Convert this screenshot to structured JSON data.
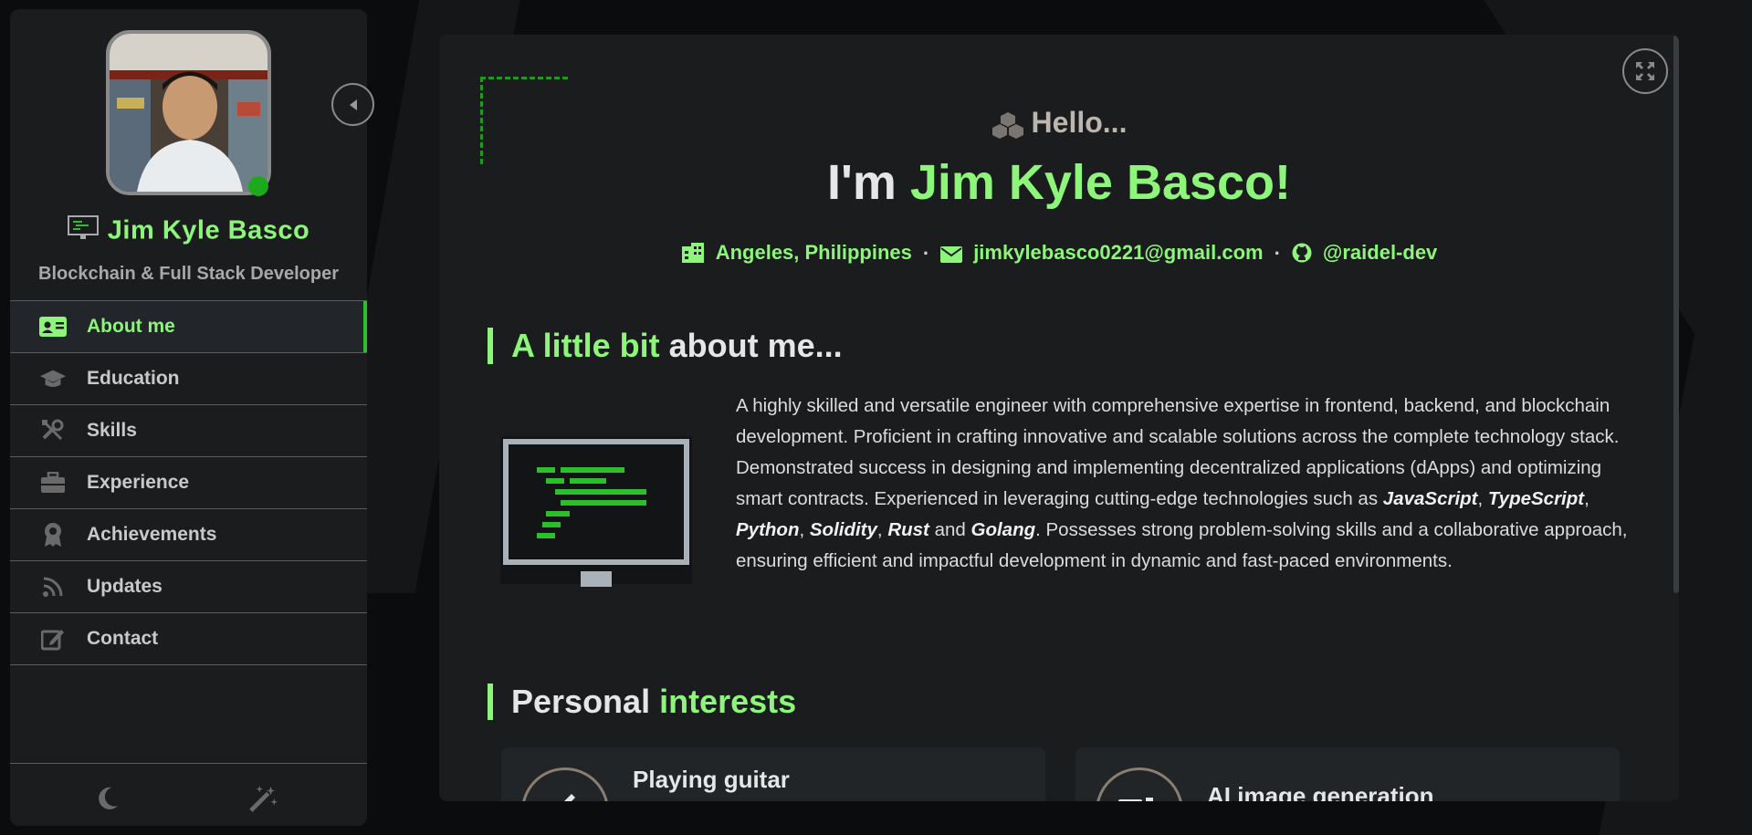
{
  "colors": {
    "accent": "#8ef57b",
    "accent_dark": "#1ea81e",
    "background": "#0b0c0d",
    "panel": "#1a1c1e"
  },
  "sidebar": {
    "name": "Jim Kyle Basco",
    "role": "Blockchain & Full Stack Developer",
    "name_icon": "monitor-icon",
    "status": "online",
    "items": [
      {
        "label": "About me",
        "icon": "id-card-icon",
        "active": true
      },
      {
        "label": "Education",
        "icon": "graduation-cap-icon",
        "active": false
      },
      {
        "label": "Skills",
        "icon": "tools-icon",
        "active": false
      },
      {
        "label": "Experience",
        "icon": "briefcase-icon",
        "active": false
      },
      {
        "label": "Achievements",
        "icon": "award-icon",
        "active": false
      },
      {
        "label": "Updates",
        "icon": "rss-icon",
        "active": false
      },
      {
        "label": "Contact",
        "icon": "edit-icon",
        "active": false
      }
    ],
    "footer": [
      {
        "icon": "moon-icon"
      },
      {
        "icon": "magic-wand-icon"
      }
    ]
  },
  "main": {
    "hello": "Hello...",
    "headline_prefix": "I'm ",
    "headline_name": "Jim Kyle Basco!",
    "location": "Angeles, Philippines",
    "email": "jimkylebasco0221@gmail.com",
    "github": "@raidel-dev",
    "separator": "·",
    "about_title_green": "A little bit",
    "about_title_white": " about me...",
    "about_text": {
      "p1": "A highly skilled and versatile engineer with comprehensive expertise in frontend, backend, and blockchain development. Proficient in crafting innovative and scalable solutions across the complete technology stack. Demonstrated success in designing and implementing decentralized applications (dApps) and optimizing smart contracts. Experienced in leveraging cutting-edge technologies such as ",
      "js": "JavaScript",
      "c1": ", ",
      "ts": "TypeScript",
      "c2": ", ",
      "py": "Python",
      "c3": ", ",
      "sol": "Solidity",
      "c4": ", ",
      "rust": "Rust",
      "and": " and ",
      "go": "Golang",
      "p2": ". Possesses strong problem-solving skills and a collaborative approach, ensuring efficient and impactful development in dynamic and fast-paced environments."
    },
    "interests_title_white": "Personal ",
    "interests_title_green": "interests",
    "interests": [
      {
        "title": "Playing guitar"
      },
      {
        "title": "AI image generation"
      }
    ]
  }
}
